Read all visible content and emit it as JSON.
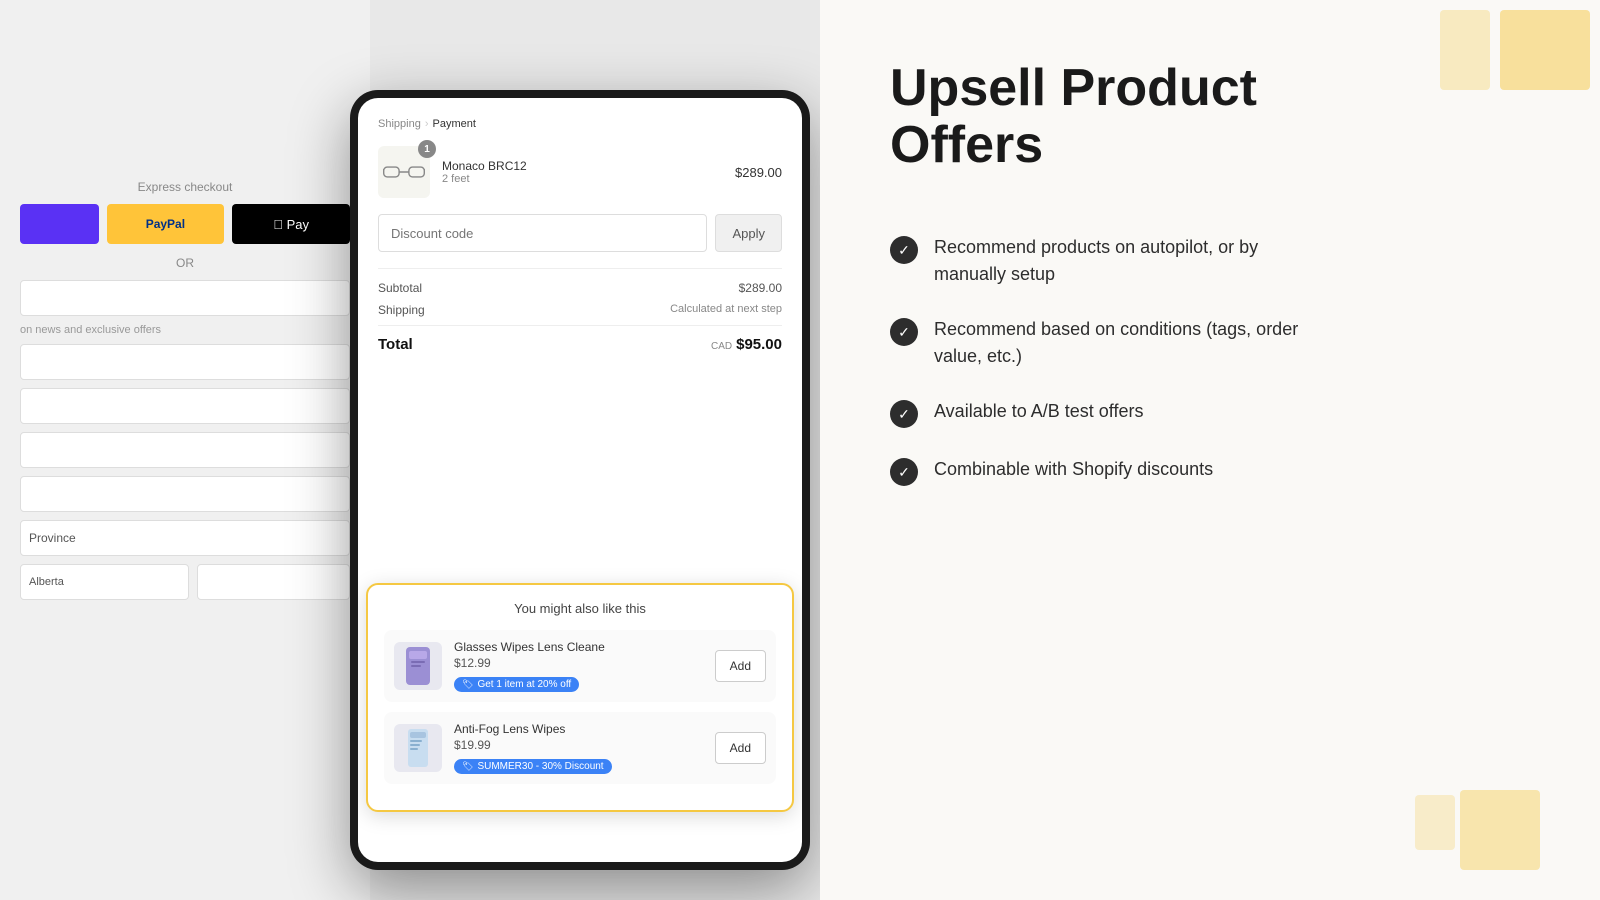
{
  "left": {
    "breadcrumb": {
      "shipping": "Shipping",
      "chevron": "›",
      "payment": "Payment"
    },
    "express_checkout": {
      "label": "Express checkout"
    },
    "product": {
      "name": "Monaco BRC12",
      "variant": "2 feet",
      "price": "$289.00",
      "badge": "1"
    },
    "discount": {
      "placeholder": "Discount code",
      "apply_label": "Apply"
    },
    "totals": {
      "subtotal_label": "Subtotal",
      "subtotal_value": "$289.00",
      "shipping_label": "Shipping",
      "shipping_value": "Calculated at next step",
      "total_label": "Total",
      "total_currency": "CAD",
      "total_value": "$95.00"
    },
    "upsell": {
      "title": "You might also like this",
      "items": [
        {
          "name": "Glasses Wipes Lens Cleane",
          "price": "$12.99",
          "tag": "Get 1 item at 20% off",
          "add_label": "Add"
        },
        {
          "name": "Anti-Fog Lens Wipes",
          "price": "$19.99",
          "tag": "SUMMER30 - 30% Discount",
          "add_label": "Add"
        }
      ]
    }
  },
  "right": {
    "title_line1": "Upsell Product",
    "title_line2": "Offers",
    "features": [
      {
        "text": "Recommend products on autopilot, or by manually setup"
      },
      {
        "text": "Recommend based on conditions (tags, order value, etc.)"
      },
      {
        "text": "Available to A/B test offers"
      },
      {
        "text": "Combinable with Shopify discounts"
      }
    ]
  }
}
